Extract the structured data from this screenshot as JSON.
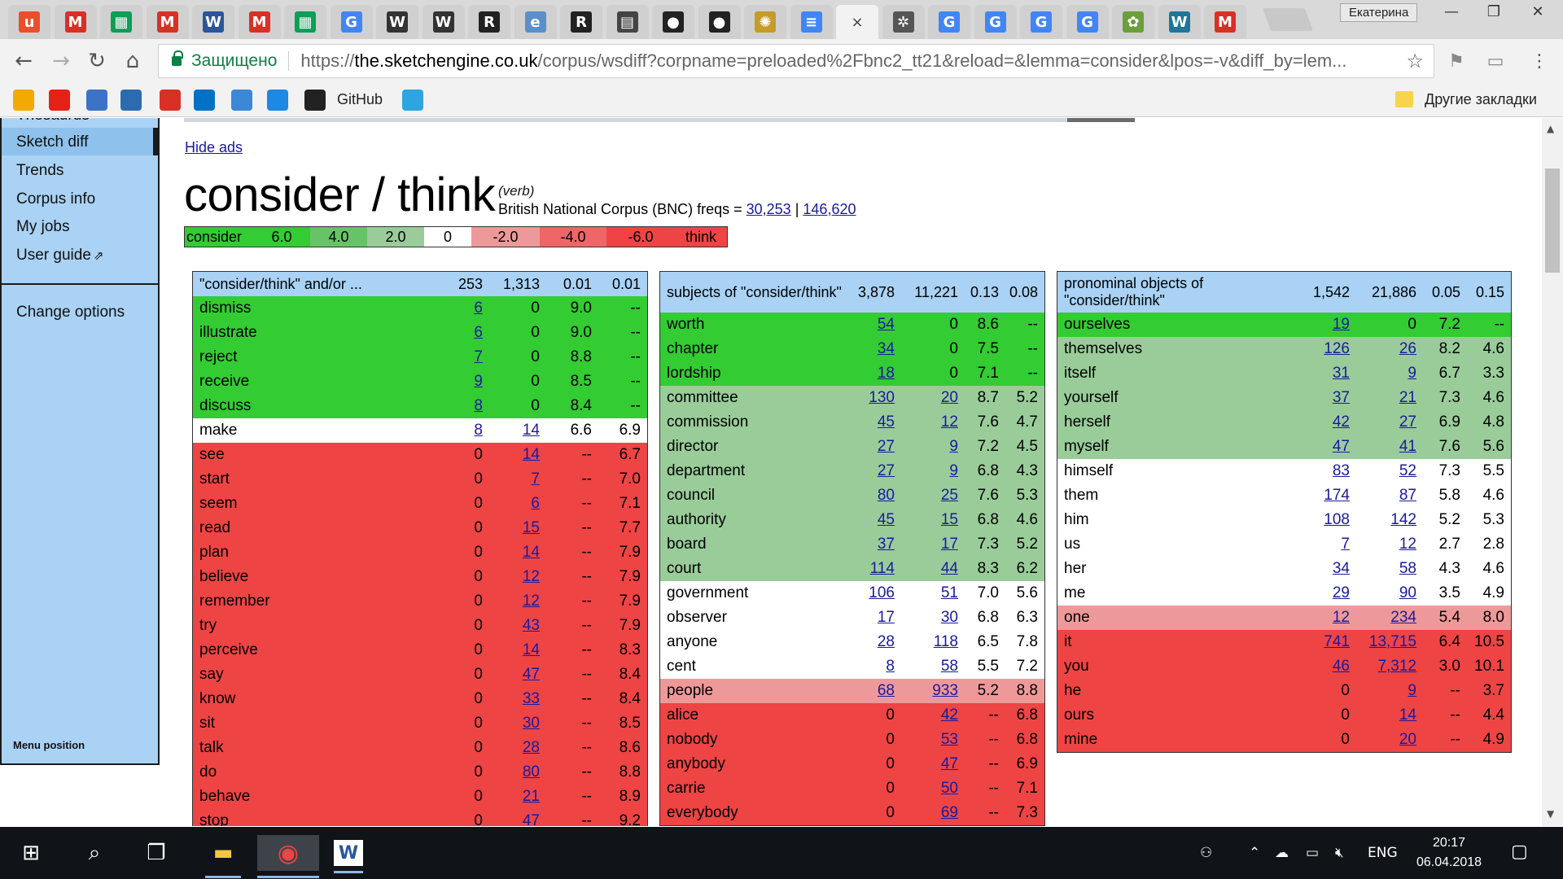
{
  "browser": {
    "profile_name": "Екатерина",
    "tabs": [
      {
        "icon": "ublock-icon",
        "glyph": "u",
        "color": "#e8502b"
      },
      {
        "icon": "gmail-icon",
        "glyph": "M",
        "color": "#d93025"
      },
      {
        "icon": "google-sheets-icon",
        "glyph": "▦",
        "color": "#0f9d58"
      },
      {
        "icon": "gmail-icon",
        "glyph": "M",
        "color": "#d93025"
      },
      {
        "icon": "word-icon",
        "glyph": "W",
        "color": "#2b579a"
      },
      {
        "icon": "gmail-icon",
        "glyph": "M",
        "color": "#d93025"
      },
      {
        "icon": "google-sheets-icon",
        "glyph": "▦",
        "color": "#0f9d58"
      },
      {
        "icon": "google-icon",
        "glyph": "G",
        "color": "#4285f4"
      },
      {
        "icon": "wikipedia-icon",
        "glyph": "W",
        "color": "#333333"
      },
      {
        "icon": "wikipedia-icon",
        "glyph": "W",
        "color": "#333333"
      },
      {
        "icon": "sketch-engine-icon",
        "glyph": "R",
        "color": "#222222"
      },
      {
        "icon": "ef-icon",
        "glyph": "e",
        "color": "#5b8fc7"
      },
      {
        "icon": "sketch-engine-icon",
        "glyph": "R",
        "color": "#222222"
      },
      {
        "icon": "book-icon",
        "glyph": "▤",
        "color": "#444444"
      },
      {
        "icon": "github-icon",
        "glyph": "●",
        "color": "#222222"
      },
      {
        "icon": "github-icon",
        "glyph": "●",
        "color": "#222222"
      },
      {
        "icon": "emblem-icon",
        "glyph": "✺",
        "color": "#c69b2a"
      },
      {
        "icon": "google-docs-icon",
        "glyph": "≡",
        "color": "#4285f4"
      },
      {
        "icon": "close-icon",
        "glyph": "×",
        "color": "#444444",
        "active": true
      },
      {
        "icon": "extension-icon",
        "glyph": "✲",
        "color": "#555555"
      },
      {
        "icon": "google-icon",
        "glyph": "G",
        "color": "#4285f4"
      },
      {
        "icon": "google-icon",
        "glyph": "G",
        "color": "#4285f4"
      },
      {
        "icon": "google-icon",
        "glyph": "G",
        "color": "#4285f4"
      },
      {
        "icon": "google-icon",
        "glyph": "G",
        "color": "#4285f4"
      },
      {
        "icon": "map-icon",
        "glyph": "✿",
        "color": "#6a9f3a"
      },
      {
        "icon": "wordpress-icon",
        "glyph": "W",
        "color": "#21759b"
      },
      {
        "icon": "gmail-icon",
        "glyph": "M",
        "color": "#d93025"
      }
    ],
    "secure_label": "Защищено",
    "url_scheme": "https://",
    "url_host": "the.sketchengine.co.uk",
    "url_path": "/corpus/wsdiff?corpname=preloaded%2Fbnc2_tt21&reload=&lemma=consider&lpos=-v&diff_by=lem...",
    "bookmarks": [
      {
        "icon": "bookmark-at-icon",
        "color": "#f2a900"
      },
      {
        "icon": "youtube-icon",
        "color": "#e62117"
      },
      {
        "icon": "chat-icon",
        "color": "#3d73c7"
      },
      {
        "icon": "bookmark-app-icon",
        "color": "#2b6cb0"
      },
      {
        "icon": "bookmark-red-icon",
        "color": "#d93025"
      },
      {
        "icon": "outlook-icon",
        "color": "#0072c6"
      },
      {
        "icon": "bookmark-refresh-icon",
        "color": "#3b88d8"
      },
      {
        "icon": "bookmark-l-icon",
        "color": "#1e88e5"
      },
      {
        "icon": "github-icon",
        "color": "#222222"
      },
      {
        "icon": "telegram-icon",
        "color": "#2ca5e0"
      }
    ],
    "bookmark_github_label": "GitHub",
    "other_bookmarks": "Другие закладки"
  },
  "sidebar": {
    "items": [
      "Thesaurus",
      "Sketch diff",
      "Trends",
      "Corpus info",
      "My jobs",
      "User guide"
    ],
    "change_options": "Change options",
    "menu_position": "Menu position"
  },
  "page": {
    "hide_ads": "Hide ads",
    "headline": "consider / think",
    "pos": "(verb)",
    "freqs_label": "British National Corpus (BNC) freqs =",
    "freq1": "30,253",
    "freq_sep": "|",
    "freq2": "146,620",
    "scale": [
      {
        "label": "consider",
        "color": "#33cc33"
      },
      {
        "label": "6.0",
        "color": "#33cc33"
      },
      {
        "label": "4.0",
        "color": "#66c466"
      },
      {
        "label": "2.0",
        "color": "#99cc99"
      },
      {
        "label": "0",
        "color": "#ffffff"
      },
      {
        "label": "-2.0",
        "color": "#ee9999"
      },
      {
        "label": "-4.0",
        "color": "#ee6666"
      },
      {
        "label": "-6.0",
        "color": "#ee4444"
      },
      {
        "label": "think",
        "color": "#ee4444"
      }
    ]
  },
  "tables": [
    {
      "title": "\"consider/think\" and/or ...",
      "head": [
        "253",
        "1,313",
        "0.01",
        "0.01"
      ],
      "rows": [
        [
          "dismiss",
          "6",
          "0",
          "9.0",
          "--",
          "g1"
        ],
        [
          "illustrate",
          "6",
          "0",
          "9.0",
          "--",
          "g1"
        ],
        [
          "reject",
          "7",
          "0",
          "8.8",
          "--",
          "g1"
        ],
        [
          "receive",
          "9",
          "0",
          "8.5",
          "--",
          "g1"
        ],
        [
          "discuss",
          "8",
          "0",
          "8.4",
          "--",
          "g1"
        ],
        [
          "make",
          "8",
          "14",
          "6.6",
          "6.9",
          "w0"
        ],
        [
          "see",
          "0",
          "14",
          "--",
          "6.7",
          "r3"
        ],
        [
          "start",
          "0",
          "7",
          "--",
          "7.0",
          "r3"
        ],
        [
          "seem",
          "0",
          "6",
          "--",
          "7.1",
          "r3"
        ],
        [
          "read",
          "0",
          "15",
          "--",
          "7.7",
          "r3"
        ],
        [
          "plan",
          "0",
          "14",
          "--",
          "7.9",
          "r3"
        ],
        [
          "believe",
          "0",
          "12",
          "--",
          "7.9",
          "r3"
        ],
        [
          "remember",
          "0",
          "12",
          "--",
          "7.9",
          "r3"
        ],
        [
          "try",
          "0",
          "43",
          "--",
          "7.9",
          "r3"
        ],
        [
          "perceive",
          "0",
          "14",
          "--",
          "8.3",
          "r3"
        ],
        [
          "say",
          "0",
          "47",
          "--",
          "8.4",
          "r3"
        ],
        [
          "know",
          "0",
          "33",
          "--",
          "8.4",
          "r3"
        ],
        [
          "sit",
          "0",
          "30",
          "--",
          "8.5",
          "r3"
        ],
        [
          "talk",
          "0",
          "28",
          "--",
          "8.6",
          "r3"
        ],
        [
          "do",
          "0",
          "80",
          "--",
          "8.8",
          "r3"
        ],
        [
          "behave",
          "0",
          "21",
          "--",
          "8.9",
          "r3"
        ],
        [
          "stop",
          "0",
          "47",
          "--",
          "9.2",
          "r3"
        ]
      ]
    },
    {
      "title": "subjects of \"consider/think\"",
      "head": [
        "3,878",
        "11,221",
        "0.13",
        "0.08"
      ],
      "rows": [
        [
          "worth",
          "54",
          "0",
          "8.6",
          "--",
          "g1"
        ],
        [
          "chapter",
          "34",
          "0",
          "7.5",
          "--",
          "g1"
        ],
        [
          "lordship",
          "18",
          "0",
          "7.1",
          "--",
          "g1"
        ],
        [
          "committee",
          "130",
          "20",
          "8.7",
          "5.2",
          "g2"
        ],
        [
          "commission",
          "45",
          "12",
          "7.6",
          "4.7",
          "g2"
        ],
        [
          "director",
          "27",
          "9",
          "7.2",
          "4.5",
          "g2"
        ],
        [
          "department",
          "27",
          "9",
          "6.8",
          "4.3",
          "g2"
        ],
        [
          "council",
          "80",
          "25",
          "7.6",
          "5.3",
          "g2"
        ],
        [
          "authority",
          "45",
          "15",
          "6.8",
          "4.6",
          "g2"
        ],
        [
          "board",
          "37",
          "17",
          "7.3",
          "5.2",
          "g2"
        ],
        [
          "court",
          "114",
          "44",
          "8.3",
          "6.2",
          "g2"
        ],
        [
          "government",
          "106",
          "51",
          "7.0",
          "5.6",
          "w0"
        ],
        [
          "observer",
          "17",
          "30",
          "6.8",
          "6.3",
          "w0"
        ],
        [
          "anyone",
          "28",
          "118",
          "6.5",
          "7.8",
          "w0"
        ],
        [
          "cent",
          "8",
          "58",
          "5.5",
          "7.2",
          "w0"
        ],
        [
          "people",
          "68",
          "933",
          "5.2",
          "8.8",
          "r2"
        ],
        [
          "alice",
          "0",
          "42",
          "--",
          "6.8",
          "r3"
        ],
        [
          "nobody",
          "0",
          "53",
          "--",
          "6.8",
          "r3"
        ],
        [
          "anybody",
          "0",
          "47",
          "--",
          "6.9",
          "r3"
        ],
        [
          "carrie",
          "0",
          "50",
          "--",
          "7.1",
          "r3"
        ],
        [
          "everybody",
          "0",
          "69",
          "--",
          "7.3",
          "r3"
        ]
      ]
    },
    {
      "title": "pronominal objects of \"consider/think\"",
      "head": [
        "1,542",
        "21,886",
        "0.05",
        "0.15"
      ],
      "rows": [
        [
          "ourselves",
          "19",
          "0",
          "7.2",
          "--",
          "g1"
        ],
        [
          "themselves",
          "126",
          "26",
          "8.2",
          "4.6",
          "g2"
        ],
        [
          "itself",
          "31",
          "9",
          "6.7",
          "3.3",
          "g2"
        ],
        [
          "yourself",
          "37",
          "21",
          "7.3",
          "4.6",
          "g2"
        ],
        [
          "herself",
          "42",
          "27",
          "6.9",
          "4.8",
          "g2"
        ],
        [
          "myself",
          "47",
          "41",
          "7.6",
          "5.6",
          "g2"
        ],
        [
          "himself",
          "83",
          "52",
          "7.3",
          "5.5",
          "w0"
        ],
        [
          "them",
          "174",
          "87",
          "5.8",
          "4.6",
          "w0"
        ],
        [
          "him",
          "108",
          "142",
          "5.2",
          "5.3",
          "w0"
        ],
        [
          "us",
          "7",
          "12",
          "2.7",
          "2.8",
          "w0"
        ],
        [
          "her",
          "34",
          "58",
          "4.3",
          "4.6",
          "w0"
        ],
        [
          "me",
          "29",
          "90",
          "3.5",
          "4.9",
          "w0"
        ],
        [
          "one",
          "12",
          "234",
          "5.4",
          "8.0",
          "r2"
        ],
        [
          "it",
          "741",
          "13,715",
          "6.4",
          "10.5",
          "r3"
        ],
        [
          "you",
          "46",
          "7,312",
          "3.0",
          "10.1",
          "r3"
        ],
        [
          "he",
          "0",
          "9",
          "--",
          "3.7",
          "r3"
        ],
        [
          "ours",
          "0",
          "14",
          "--",
          "4.4",
          "r3"
        ],
        [
          "mine",
          "0",
          "20",
          "--",
          "4.9",
          "r3"
        ]
      ]
    }
  ],
  "taskbar": {
    "lang": "ENG",
    "time": "20:17",
    "date": "06.04.2018"
  }
}
